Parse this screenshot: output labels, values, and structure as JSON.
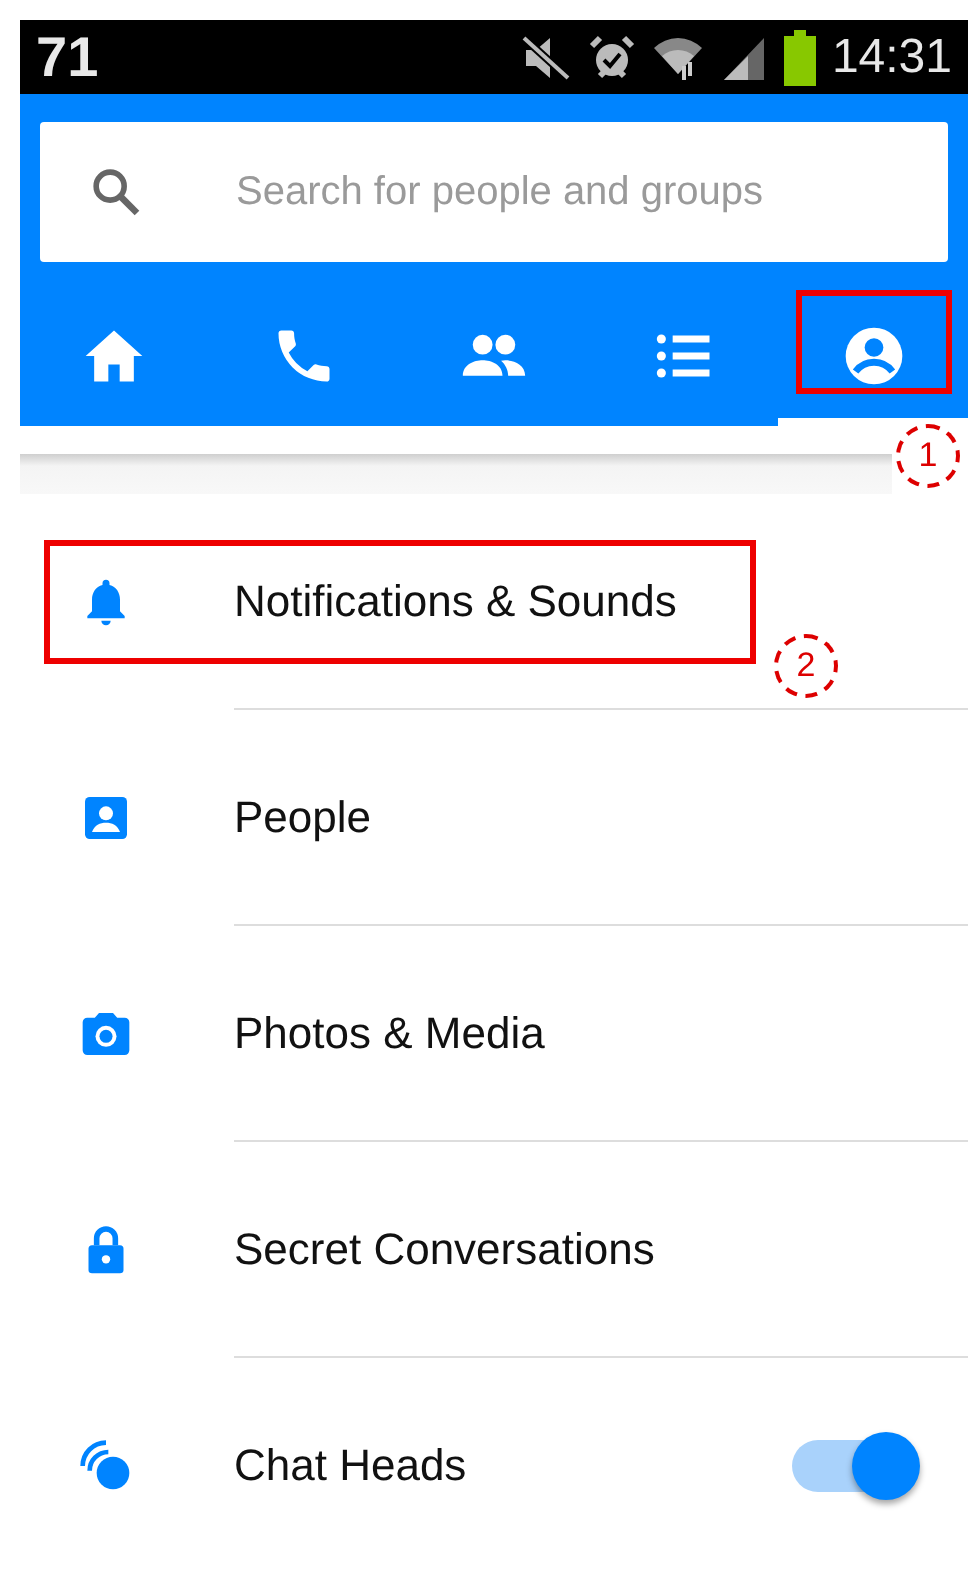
{
  "status_bar": {
    "left_text": "71",
    "time": "14:31"
  },
  "search": {
    "placeholder": "Search for people and groups"
  },
  "tabs": [
    {
      "selected": false
    },
    {
      "selected": false
    },
    {
      "selected": false
    },
    {
      "selected": false
    },
    {
      "selected": true
    }
  ],
  "settings": [
    {
      "kind": "link",
      "label": "Notifications & Sounds"
    },
    {
      "kind": "link",
      "label": "People"
    },
    {
      "kind": "link",
      "label": "Photos & Media"
    },
    {
      "kind": "link",
      "label": "Secret Conversations"
    },
    {
      "kind": "toggle",
      "label": "Chat Heads",
      "on": true
    }
  ],
  "annotations": [
    {
      "label": "1"
    },
    {
      "label": "2"
    }
  ]
}
